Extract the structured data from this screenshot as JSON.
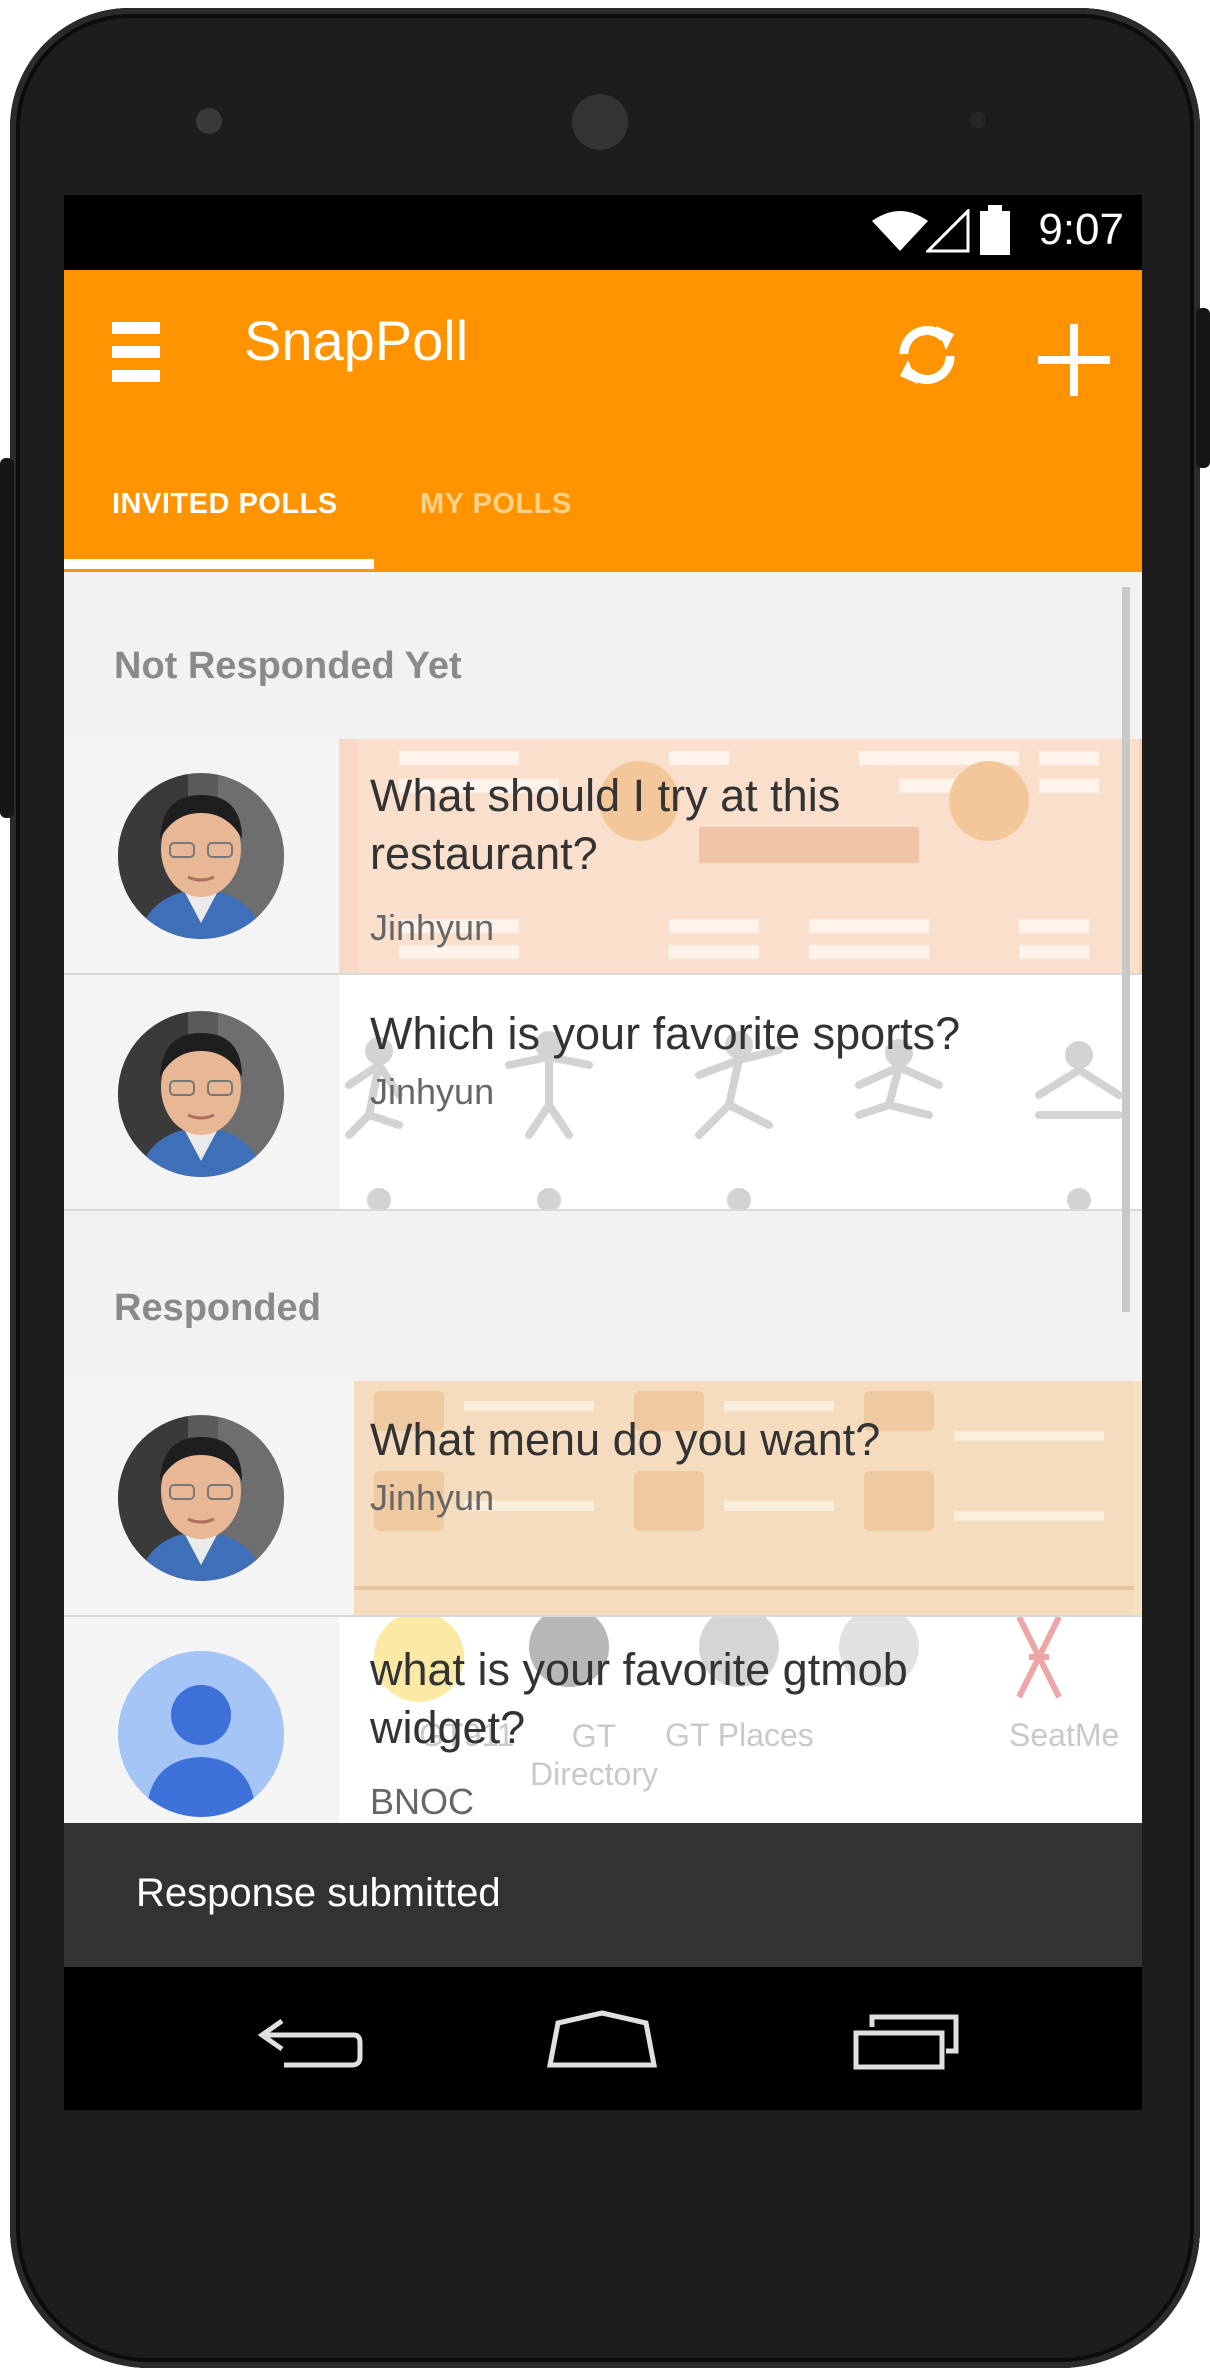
{
  "status_bar": {
    "time": "9:07"
  },
  "app_bar": {
    "title": "SnapPoll"
  },
  "tabs": [
    {
      "label": "INVITED POLLS",
      "selected": true
    },
    {
      "label": "MY POLLS",
      "selected": false
    }
  ],
  "sections": {
    "not_responded": {
      "title": "Not Responded Yet",
      "polls": [
        {
          "question": "What should I try at this restaurant?",
          "author": "Jinhyun"
        },
        {
          "question": "Which is your favorite sports?",
          "author": "Jinhyun"
        }
      ]
    },
    "responded": {
      "title": "Responded",
      "polls": [
        {
          "question": "What menu do you want?",
          "author": "Jinhyun"
        },
        {
          "question": "what is your favorite gtmob widget?",
          "author": "BNOC",
          "bg_labels": [
            "GT911",
            "GT Directory",
            "GT Places",
            "SeatMe"
          ]
        }
      ]
    }
  },
  "snackbar": {
    "message": "Response submitted"
  },
  "colors": {
    "accent": "#ff9400",
    "snackbar": "#323232"
  }
}
